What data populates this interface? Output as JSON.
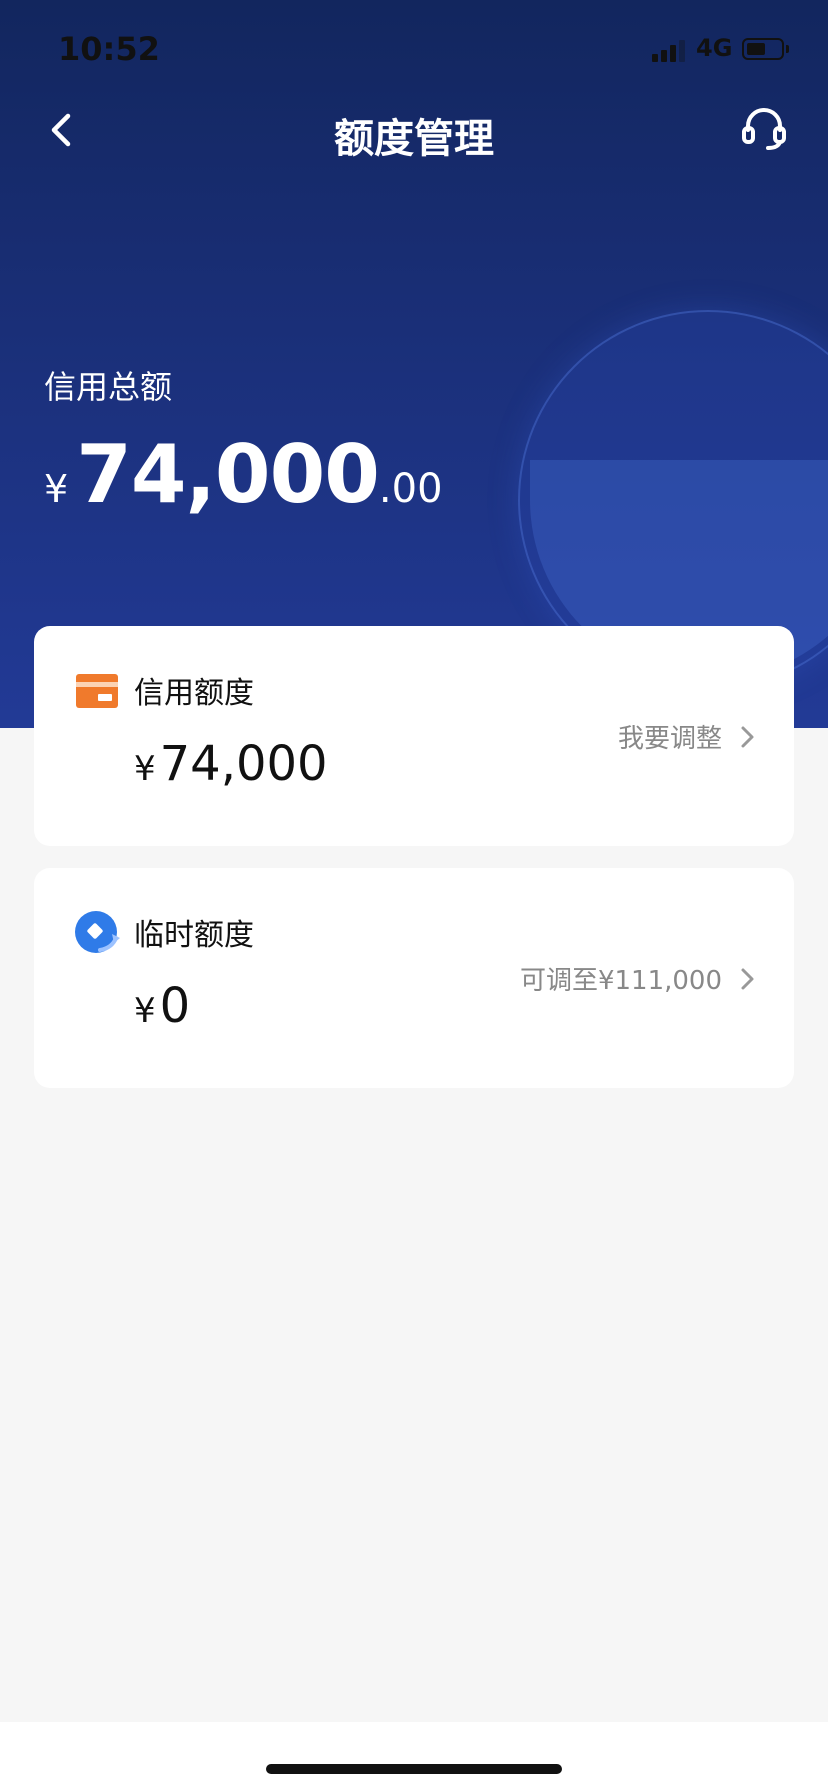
{
  "status_bar": {
    "time": "10:52",
    "network": "4G",
    "battery_level": 0.55
  },
  "nav": {
    "title": "额度管理",
    "back_icon": "chevron-left-icon",
    "service_icon": "headset-icon"
  },
  "total": {
    "label": "信用总额",
    "currency": "¥",
    "integer": "74,000",
    "decimal": ".00"
  },
  "cards": [
    {
      "icon": "credit-card-icon",
      "title": "信用额度",
      "currency": "¥",
      "amount": "74,000",
      "action": "我要调整"
    },
    {
      "icon": "temp-credit-icon",
      "title": "临时额度",
      "currency": "¥",
      "amount": "0",
      "action": "可调至¥111,000"
    }
  ],
  "colors": {
    "hero_dark": "#12265e",
    "hero_light": "#223a96",
    "card_icon_orange": "#f07a2c",
    "card_icon_blue": "#2f7be8"
  }
}
